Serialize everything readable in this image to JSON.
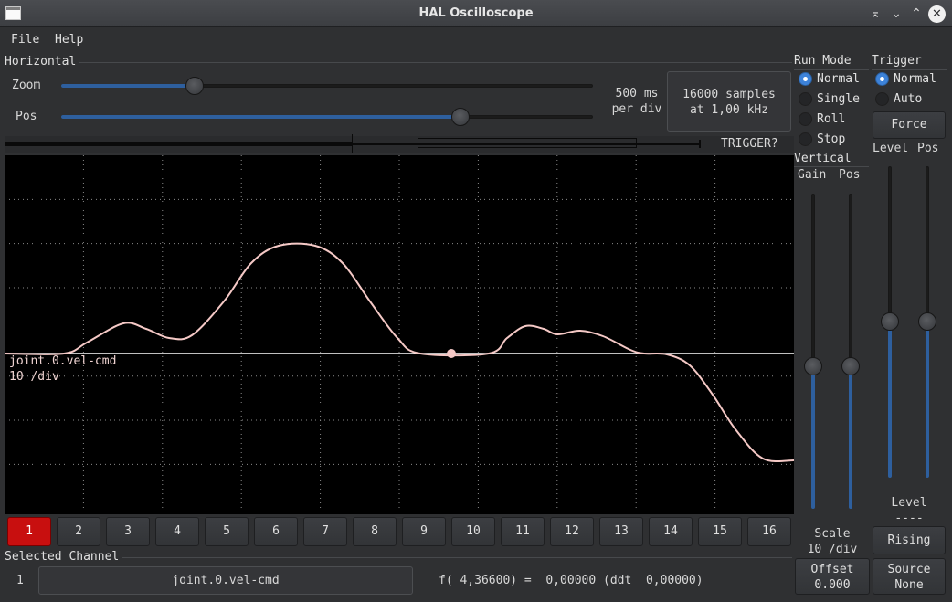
{
  "window": {
    "title": "HAL Oscilloscope",
    "controls": [
      "⌅",
      "⌄",
      "⌃",
      "✕"
    ]
  },
  "menubar": {
    "items": [
      "File",
      "Help"
    ]
  },
  "horizontal": {
    "group_label": "Horizontal",
    "zoom_label": "Zoom",
    "zoom_level": 0.25,
    "pos_label": "Pos",
    "pos_level": 0.75,
    "timebase_value": "500 ms",
    "timebase_unit": "per div",
    "samples_line1": "16000 samples",
    "samples_line2": "at 1,00 kHz",
    "trigger_status": "TRIGGER?"
  },
  "run_mode": {
    "label": "Run Mode",
    "options": [
      {
        "label": "Normal",
        "selected": true
      },
      {
        "label": "Single",
        "selected": false
      },
      {
        "label": "Roll",
        "selected": false
      },
      {
        "label": "Stop",
        "selected": false
      }
    ]
  },
  "trigger": {
    "label": "Trigger",
    "options": [
      {
        "label": "Normal",
        "selected": true
      },
      {
        "label": "Auto",
        "selected": false
      }
    ],
    "force_label": "Force",
    "level_label": "Level",
    "pos_label": "Pos",
    "level_title": "Level",
    "level_value": "----",
    "edge_button": "Rising",
    "source_label": "Source",
    "source_value": "None",
    "level_slider": 0.5,
    "pos_slider": 0.5
  },
  "vertical": {
    "label": "Vertical",
    "gain_label": "Gain",
    "pos_label": "Pos",
    "gain_slider": 0.45,
    "pos_slider": 0.45,
    "scale_label": "Scale",
    "scale_value": "10 /div",
    "offset_label": "Offset",
    "offset_value": "0.000"
  },
  "screen": {
    "channel_name": "joint.0.vel-cmd",
    "channel_scale": "10 /div",
    "trace_color": "#f5c9c6",
    "background": "#000000"
  },
  "channels": {
    "buttons": [
      "1",
      "2",
      "3",
      "4",
      "5",
      "6",
      "7",
      "8",
      "9",
      "10",
      "11",
      "12",
      "13",
      "14",
      "15",
      "16"
    ],
    "active_index": 0
  },
  "selected_channel": {
    "label": "Selected Channel",
    "number": "1",
    "name": "joint.0.vel-cmd",
    "readout": "f( 4,36600) =  0,00000 (ddt  0,00000)"
  }
}
